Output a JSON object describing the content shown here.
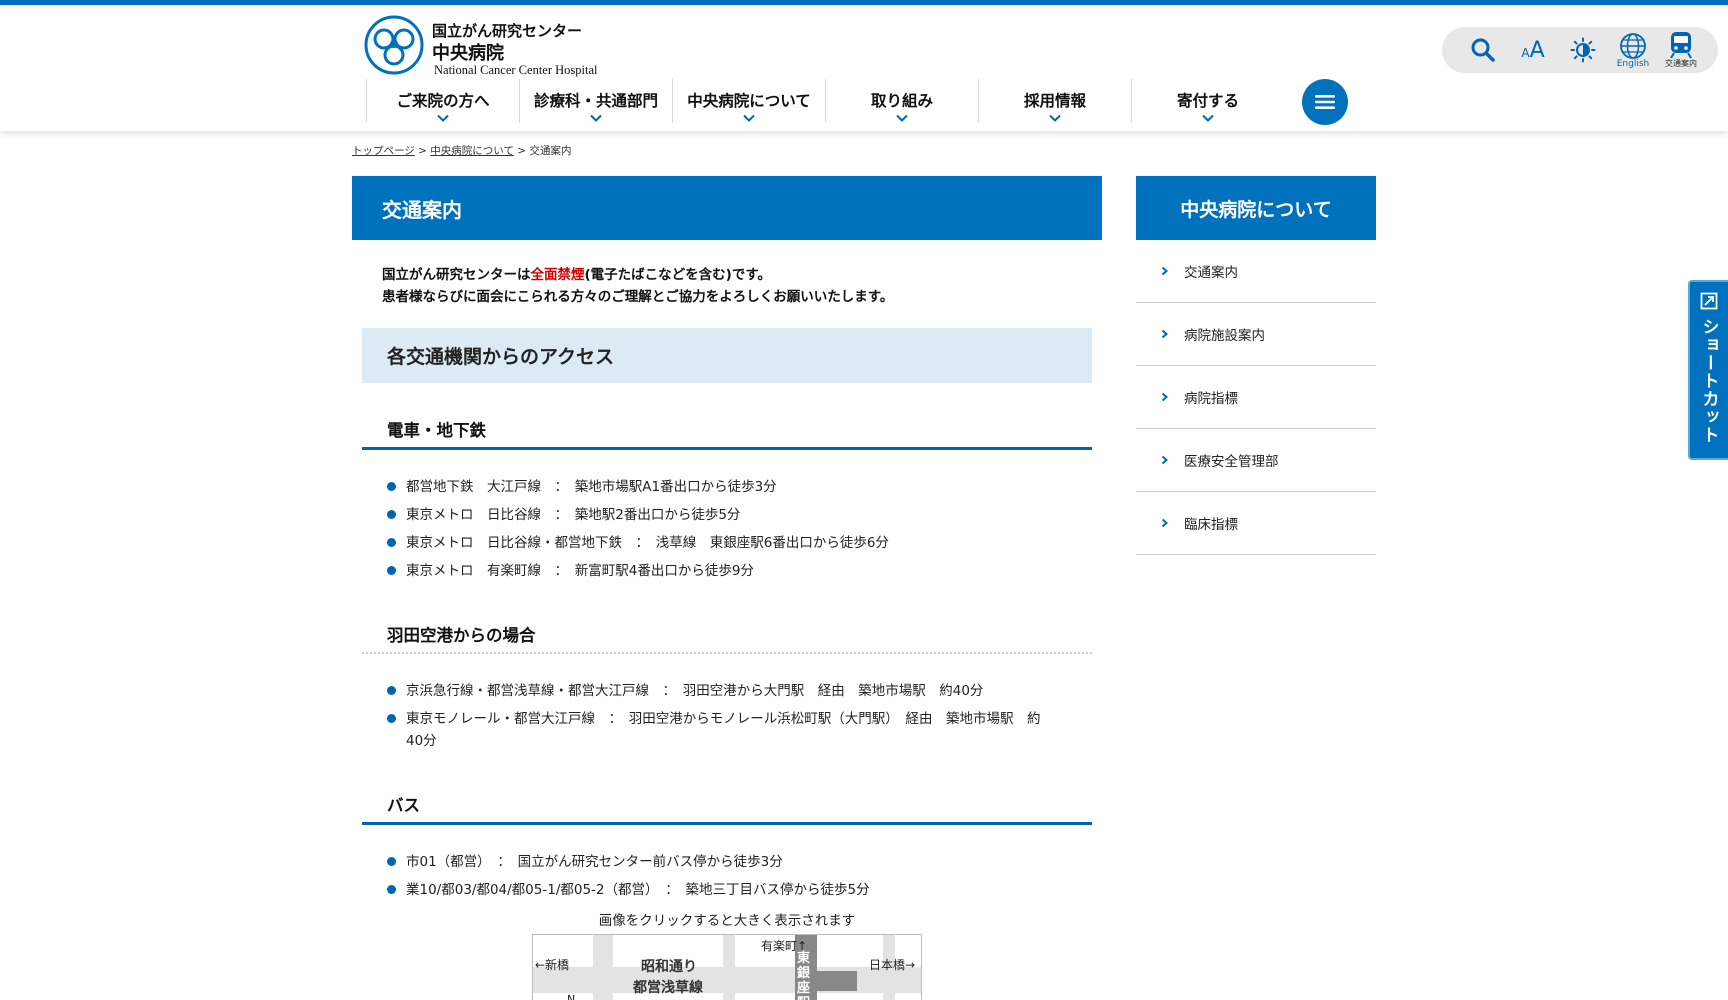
{
  "header": {
    "logo_line1": "国立がん研究センター",
    "logo_line2": "中央病院",
    "logo_line3": "National Cancer Center Hospital",
    "tools": {
      "search_icon": "search-icon",
      "font_size_label": "A",
      "font_size_small": "A",
      "contrast_icon": "contrast-icon",
      "english_label": "English",
      "access_label": "交通案内"
    },
    "nav": [
      {
        "label": "ご来院の方へ"
      },
      {
        "label": "診療科・共通部門"
      },
      {
        "label": "中央病院について"
      },
      {
        "label": "取り組み"
      },
      {
        "label": "採用情報"
      },
      {
        "label": "寄付する"
      }
    ]
  },
  "breadcrumb": {
    "home": "トップページ",
    "sep1": " > ",
    "parent": "中央病院について",
    "sep2": " > ",
    "current": "交通案内"
  },
  "main": {
    "title": "交通案内",
    "notice_line1_pre": "国立がん研究センターは",
    "notice_line1_red": "全面禁煙",
    "notice_line1_post": "(電子たばこなどを含む)です。",
    "notice_line2": "患者様ならびに面会にこられる方々のご理解とご協力をよろしくお願いいたします。",
    "access_heading": "各交通機関からのアクセス",
    "train_heading": "電車・地下鉄",
    "train_items": [
      "都営地下鉄　大江戸線　：　築地市場駅A1番出口から徒歩3分",
      "東京メトロ　日比谷線　：　築地駅2番出口から徒歩5分",
      "東京メトロ　日比谷線・都営地下鉄　：　浅草線　東銀座駅6番出口から徒歩6分",
      "東京メトロ　有楽町線　：　新富町駅4番出口から徒歩9分"
    ],
    "airport_heading": "羽田空港からの場合",
    "airport_items": [
      "京浜急行線・都営浅草線・都営大江戸線　：　羽田空港から大門駅　経由　築地市場駅　約40分",
      "東京モノレール・都営大江戸線　：　羽田空港からモノレール浜松町駅（大門駅）　経由　築地市場駅　約40分"
    ],
    "bus_heading": "バス",
    "bus_items": [
      "市01（都営）　：　国立がん研究センター前バス停から徒歩3分",
      "業10/都03/都04/都05-1/都05-2（都営）　：　築地三丁目バス停から徒歩5分"
    ],
    "map_caption": "画像をクリックすると大きく表示されます",
    "map": {
      "shimbashi": "←新橋",
      "yurakucho": "有楽町↑",
      "nihombashi": "日本橋→",
      "showa_dori": "昭和通り",
      "asakusa_line": "都営浅草線",
      "higashi_ginza": "東銀座駅",
      "north": "N"
    }
  },
  "side": {
    "title": "中央病院について",
    "items": [
      {
        "label": "交通案内"
      },
      {
        "label": "病院施設案内"
      },
      {
        "label": "病院指標"
      },
      {
        "label": "医療安全管理部"
      },
      {
        "label": "臨床指標"
      }
    ]
  },
  "shortcut": {
    "label": "ショートカット"
  },
  "colors": {
    "brand_blue": "#0071bc",
    "heading_bg": "#dcebf3",
    "notice_red": "#d40000"
  }
}
